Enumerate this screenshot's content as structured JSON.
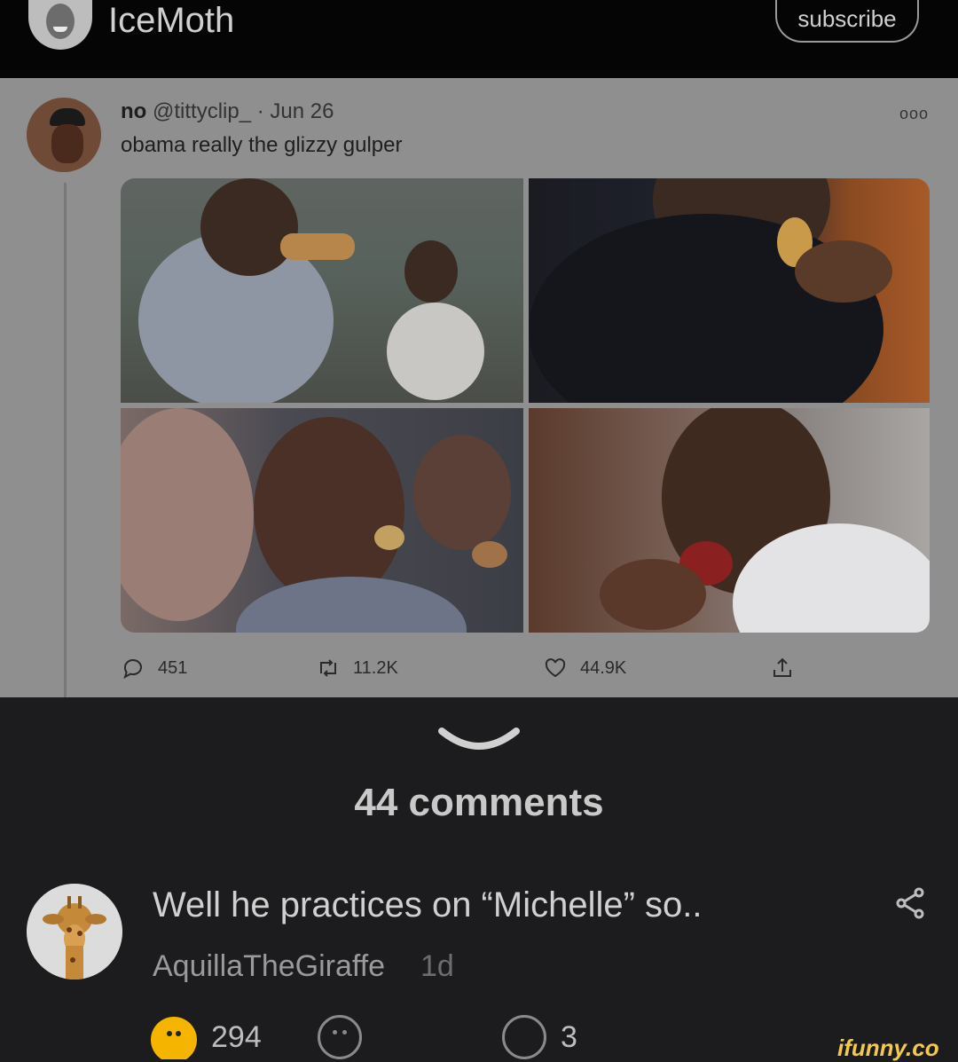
{
  "header": {
    "channel_name": "IceMoth",
    "subscribe_label": "subscribe"
  },
  "tweet": {
    "display_name": "no",
    "handle": "@tittyclip_",
    "separator": "·",
    "date": "Jun 26",
    "text": "obama really the glizzy gulper",
    "more_glyph": "ooo",
    "reply_count": "451",
    "retweet_count": "11.2K",
    "like_count": "44.9K"
  },
  "comments": {
    "count_label": "44 comments",
    "items": [
      {
        "text": "Well he practices on “Michelle” so..",
        "username": "AquillaTheGiraffe",
        "time": "1d",
        "smile_count": "294",
        "reply_count": "3"
      }
    ]
  },
  "watermark": "ifunny.co",
  "colors": {
    "accent_smile": "#f5b400",
    "watermark": "#f2c94c",
    "background": "#1c1c1e"
  }
}
